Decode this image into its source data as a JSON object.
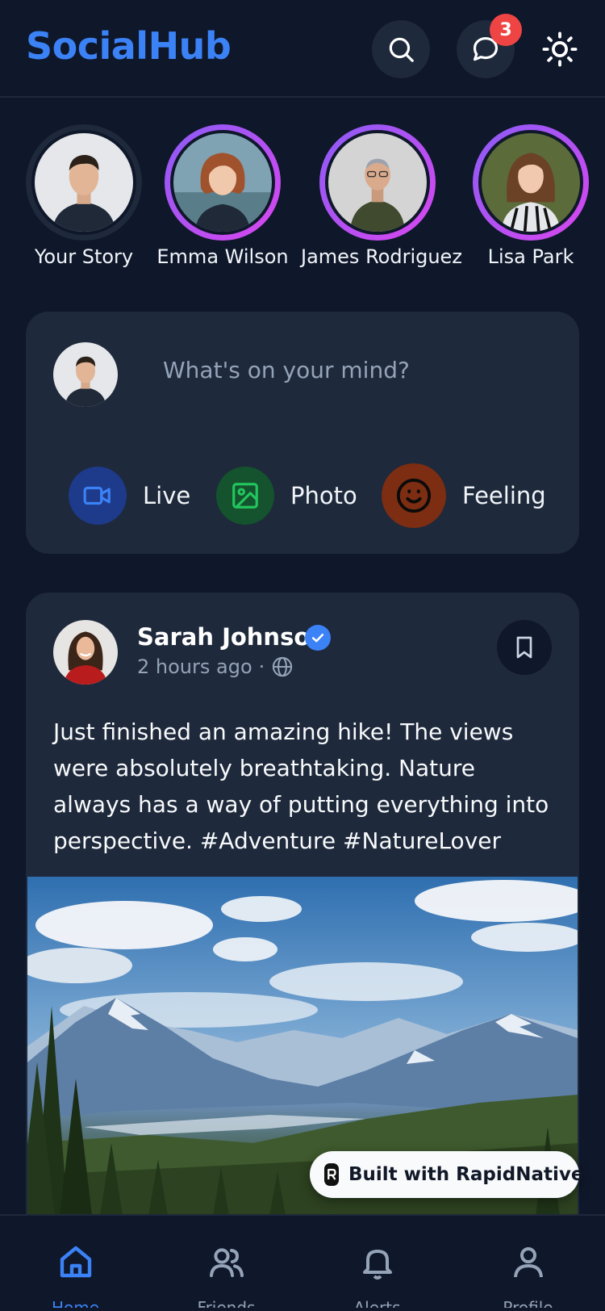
{
  "app": {
    "title": "SocialHub"
  },
  "header": {
    "notifications_count": "3",
    "icons": [
      "search-icon",
      "chat-icon",
      "sun-icon"
    ]
  },
  "stories": [
    {
      "name": "Your Story",
      "has_new": false
    },
    {
      "name": "Emma Wilson",
      "has_new": true
    },
    {
      "name": "James Rodriguez",
      "has_new": true
    },
    {
      "name": "Lisa Park",
      "has_new": true
    }
  ],
  "composer": {
    "placeholder": "What's on your mind?",
    "actions": [
      {
        "label": "Live",
        "icon": "video-icon"
      },
      {
        "label": "Photo",
        "icon": "image-icon"
      },
      {
        "label": "Feeling",
        "icon": "smile-icon"
      }
    ]
  },
  "post": {
    "author": "Sarah Johnson",
    "verified": true,
    "time": "2 hours ago",
    "separator": "·",
    "visibility_icon": "globe-icon",
    "text": "Just finished an amazing hike! The views were absolutely breathtaking. Nature always has a way of putting everything into perspective. #Adventure #NatureLover"
  },
  "badge": {
    "label": "Built with RapidNative"
  },
  "bottom_nav": [
    {
      "label": "Home",
      "icon": "home-icon",
      "active": true
    },
    {
      "label": "Friends",
      "icon": "users-icon",
      "active": false
    },
    {
      "label": "Alerts",
      "icon": "bell-icon",
      "active": false
    },
    {
      "label": "Profile",
      "icon": "user-icon",
      "active": false
    }
  ],
  "colors": {
    "background": "#0f172a",
    "card": "#1e293b",
    "accent": "#3b82f6",
    "badge": "#ef4444",
    "story_ring": "#a855f7"
  }
}
